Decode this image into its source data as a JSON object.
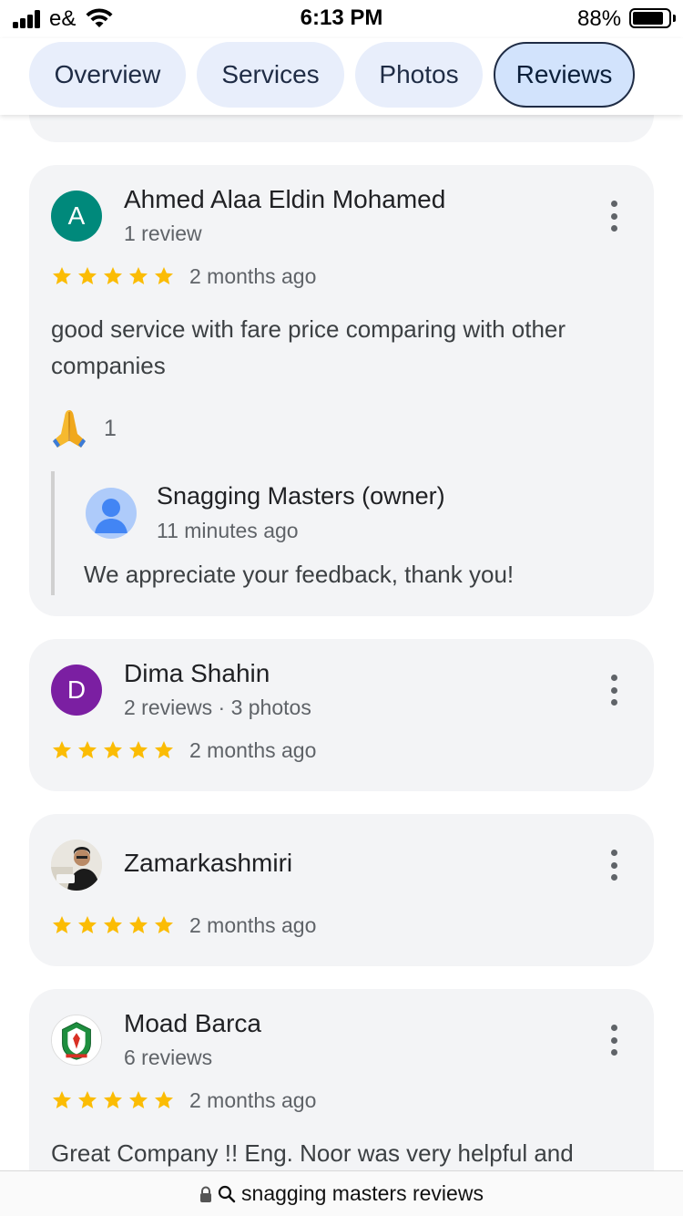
{
  "status_bar": {
    "carrier": "e&",
    "time": "6:13 PM",
    "battery_percent": "88%",
    "battery_level": 0.88
  },
  "tabs": [
    {
      "label": "Overview",
      "active": false
    },
    {
      "label": "Services",
      "active": false
    },
    {
      "label": "Photos",
      "active": false
    },
    {
      "label": "Reviews",
      "active": true
    }
  ],
  "reviews": [
    {
      "avatar_letter": "A",
      "avatar_color": "#00897b",
      "name": "Ahmed Alaa Eldin Mohamed",
      "meta": "1 review",
      "rating": 5,
      "time": "2 months ago",
      "text": "good service with fare price comparing with other companies",
      "reaction_icon": "folded-hands-emoji",
      "reaction_count": "1",
      "owner_reply": {
        "name": "Snagging Masters (owner)",
        "time": "11 minutes ago",
        "text": "We appreciate your feedback, thank you!"
      }
    },
    {
      "avatar_letter": "D",
      "avatar_color": "#7b1fa2",
      "name": "Dima Shahin",
      "meta": "2 reviews · 3 photos",
      "rating": 5,
      "time": "2 months ago"
    },
    {
      "avatar_icon": "profile-photo",
      "name": "Zamarkashmiri",
      "rating": 5,
      "time": "2 months ago"
    },
    {
      "avatar_icon": "club-logo",
      "name": "Moad Barca",
      "meta": "6 reviews",
      "rating": 5,
      "time": "2 months ago",
      "text": "Great Company !! Eng. Noor was very helpful and"
    }
  ],
  "url_bar": {
    "text": "snagging masters reviews"
  },
  "colors": {
    "star": "#fbbc04",
    "tab_bg": "#e8eefb",
    "tab_active_bg": "#d2e3fc",
    "card_bg": "#f3f4f6"
  }
}
